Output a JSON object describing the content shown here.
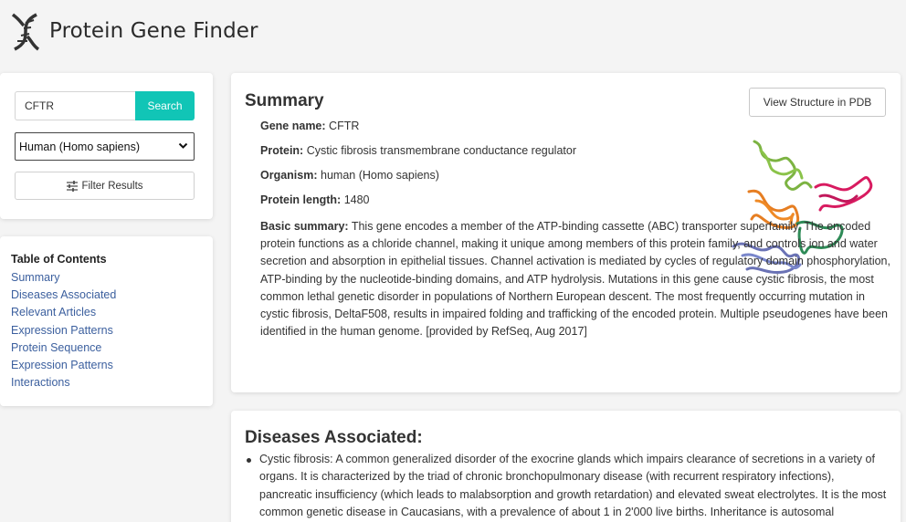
{
  "app": {
    "title": "Protein Gene Finder",
    "logo_icon": "dna-icon"
  },
  "search": {
    "value": "CFTR",
    "placeholder": "",
    "button_label": "Search"
  },
  "organism_select": {
    "selected": "Human (Homo sapiens)"
  },
  "filter": {
    "label": "Filter Results",
    "icon": "sliders-icon"
  },
  "toc": {
    "title": "Table of Contents",
    "links": [
      "Summary",
      "Diseases Associated",
      "Relevant Articles",
      "Expression Patterns",
      "Protein Sequence",
      "Expression Patterns",
      "Interactions"
    ]
  },
  "summary": {
    "title": "Summary",
    "pdb_button": "View Structure in PDB",
    "gene_name_label": "Gene name:",
    "gene_name": "CFTR",
    "protein_label": "Protein:",
    "protein": "Cystic fibrosis transmembrane conductance regulator",
    "organism_label": "Organism:",
    "organism": "human (Homo sapiens)",
    "length_label": "Protein length:",
    "length": "1480",
    "basic_label": "Basic summary:",
    "basic": "This gene encodes a member of the ATP-binding cassette (ABC) transporter superfamily. The encoded protein functions as a chloride channel, making it unique among members of this protein family, and controls ion and water secretion and absorption in epithelial tissues. Channel activation is mediated by cycles of regulatory domain phosphorylation, ATP-binding by the nucleotide-binding domains, and ATP hydrolysis. Mutations in this gene cause cystic fibrosis, the most common lethal genetic disorder in populations of Northern European descent. The most frequently occurring mutation in cystic fibrosis, DeltaF508, results in impaired folding and trafficking of the encoded protein. Multiple pseudogenes have been identified in the human genome. [provided by RefSeq, Aug 2017]"
  },
  "diseases": {
    "title": "Diseases Associated:",
    "items": [
      "Cystic fibrosis: A common generalized disorder of the exocrine glands which impairs clearance of secretions in a variety of organs. It is characterized by the triad of chronic bronchopulmonary disease (with recurrent respiratory infections), pancreatic insufficiency (which leads to malabsorption and growth retardation) and elevated sweat electrolytes. It is the most common genetic disease in Caucasians, with a prevalence of about 1 in 2'000 live births. Inheritance is autosomal"
    ]
  },
  "colors": {
    "accent": "#11c5b6",
    "link": "#3b5f9e",
    "background": "#f4f4f4"
  }
}
